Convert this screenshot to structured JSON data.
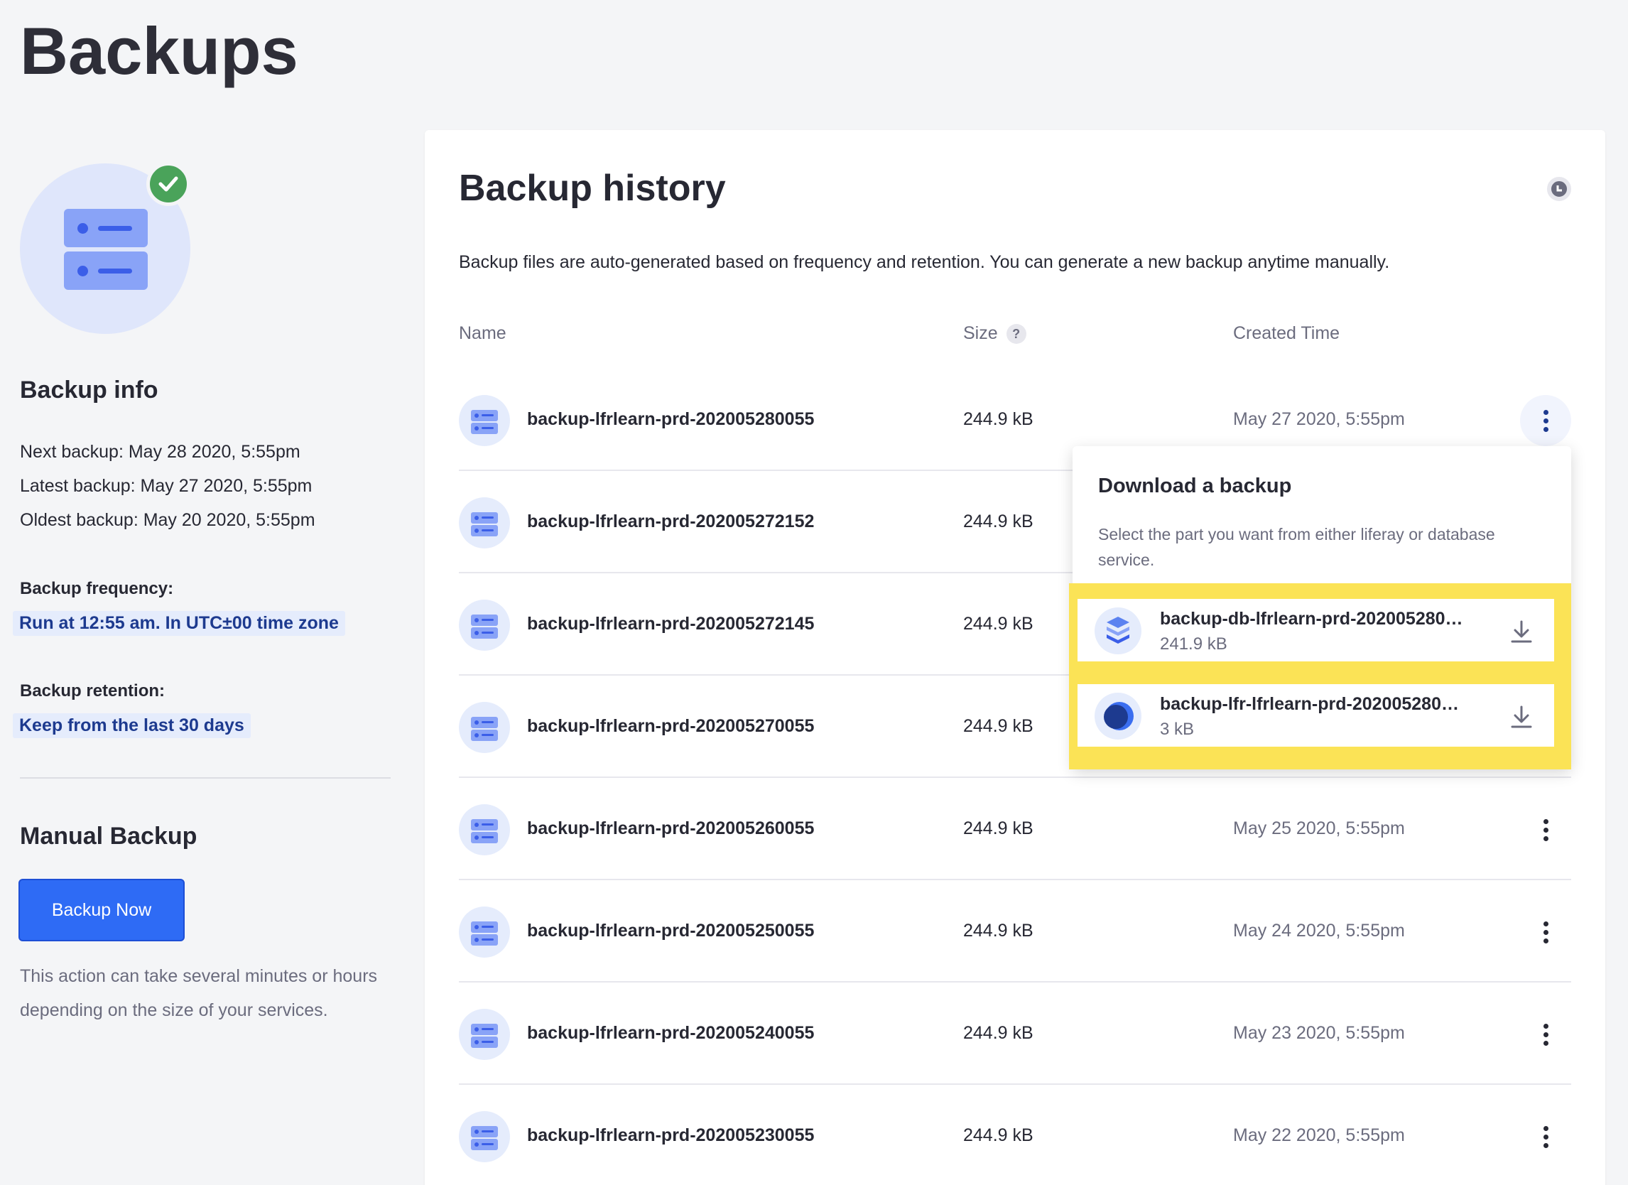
{
  "page": {
    "title": "Backups"
  },
  "backup_info": {
    "title": "Backup info",
    "next": "Next backup: May 28 2020, 5:55pm",
    "latest": "Latest backup: May 27 2020, 5:55pm",
    "oldest": "Oldest backup: May 20 2020, 5:55pm",
    "frequency_label": "Backup frequency:",
    "frequency_value": "Run at 12:55 am. In UTC±00 time zone",
    "retention_label": "Backup retention:",
    "retention_value": "Keep from the last 30 days"
  },
  "manual": {
    "title": "Manual Backup",
    "button": "Backup Now",
    "help": "This action can take several minutes or hours depending on the size of your services."
  },
  "history": {
    "title": "Backup history",
    "description": "Backup files are auto-generated based on frequency and retention. You can generate a new backup anytime manually.",
    "columns": {
      "name": "Name",
      "size": "Size",
      "size_help": "?",
      "created": "Created Time"
    },
    "rows": [
      {
        "name": "backup-lfrlearn-prd-202005280055",
        "size": "244.9 kB",
        "created": "May 27 2020, 5:55pm"
      },
      {
        "name": "backup-lfrlearn-prd-202005272152",
        "size": "244.9 kB",
        "created": ""
      },
      {
        "name": "backup-lfrlearn-prd-202005272145",
        "size": "244.9 kB",
        "created": ""
      },
      {
        "name": "backup-lfrlearn-prd-202005270055",
        "size": "244.9 kB",
        "created": ""
      },
      {
        "name": "backup-lfrlearn-prd-202005260055",
        "size": "244.9 kB",
        "created": "May 25 2020, 5:55pm"
      },
      {
        "name": "backup-lfrlearn-prd-202005250055",
        "size": "244.9 kB",
        "created": "May 24 2020, 5:55pm"
      },
      {
        "name": "backup-lfrlearn-prd-202005240055",
        "size": "244.9 kB",
        "created": "May 23 2020, 5:55pm"
      },
      {
        "name": "backup-lfrlearn-prd-202005230055",
        "size": "244.9 kB",
        "created": "May 22 2020, 5:55pm"
      }
    ]
  },
  "download": {
    "title": "Download a backup",
    "description": "Select the part you want from either liferay or database service.",
    "items": [
      {
        "name": "backup-db-lfrlearn-prd-202005280…",
        "size": "241.9 kB",
        "icon": "database-icon"
      },
      {
        "name": "backup-lfr-lfrlearn-prd-202005280…",
        "size": "3 kB",
        "icon": "liferay-icon"
      }
    ]
  },
  "colors": {
    "accent": "#2e6bf5",
    "highlight": "#fbe356",
    "success": "#4aa35a"
  }
}
